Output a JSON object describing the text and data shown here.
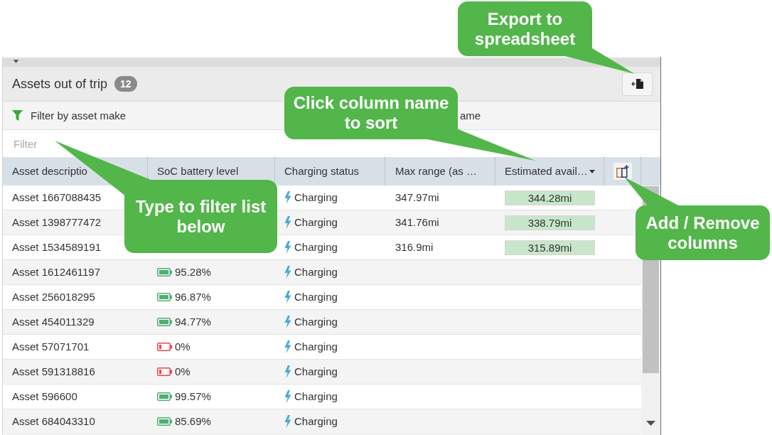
{
  "panel": {
    "title": "Assets out of trip",
    "count": "12"
  },
  "filters": [
    {
      "label": "Filter by asset make",
      "icon_shown": true
    },
    {
      "label": "ame",
      "icon_shown": false
    }
  ],
  "search": {
    "placeholder": "Filter"
  },
  "table": {
    "columns": [
      {
        "label": "Asset descriptio",
        "sorted": false
      },
      {
        "label": "SoC battery level",
        "sorted": false
      },
      {
        "label": "Charging status",
        "sorted": false
      },
      {
        "label": "Max range (as …",
        "sorted": false
      },
      {
        "label": "Estimated avail…",
        "sorted": true
      }
    ],
    "rows": [
      {
        "asset": "Asset 1667088435",
        "charging": "Charging",
        "max_range": "347.97mi",
        "estimated_range": "344.28mi"
      },
      {
        "asset": "Asset 1398777472",
        "charging": "Charging",
        "max_range": "341.76mi",
        "estimated_range": "338.79mi"
      },
      {
        "asset": "Asset 1534589191",
        "charging": "Charging",
        "max_range": "316.9mi",
        "estimated_range": "315.89mi"
      },
      {
        "asset": "Asset 1612461197",
        "soc": {
          "value": "95.28%",
          "low": false
        },
        "charging": "Charging"
      },
      {
        "asset": "Asset 256018295",
        "soc": {
          "value": "96.87%",
          "low": false
        },
        "charging": "Charging"
      },
      {
        "asset": "Asset 454011329",
        "soc": {
          "value": "94.77%",
          "low": false
        },
        "charging": "Charging"
      },
      {
        "asset": "Asset 57071701",
        "soc": {
          "value": "0%",
          "low": true
        },
        "charging": "Charging"
      },
      {
        "asset": "Asset 591318816",
        "soc": {
          "value": "0%",
          "low": true
        },
        "charging": "Charging"
      },
      {
        "asset": "Asset 596600",
        "soc": {
          "value": "99.57%",
          "low": false
        },
        "charging": "Charging"
      },
      {
        "asset": "Asset 684043310",
        "soc": {
          "value": "85.69%",
          "low": false
        },
        "charging": "Charging"
      }
    ]
  },
  "annotations": [
    {
      "text": "Export to spreadsheet"
    },
    {
      "text": "Click column name to sort"
    },
    {
      "text": "Type to filter list below"
    },
    {
      "text": "Add / Remove columns"
    }
  ]
}
